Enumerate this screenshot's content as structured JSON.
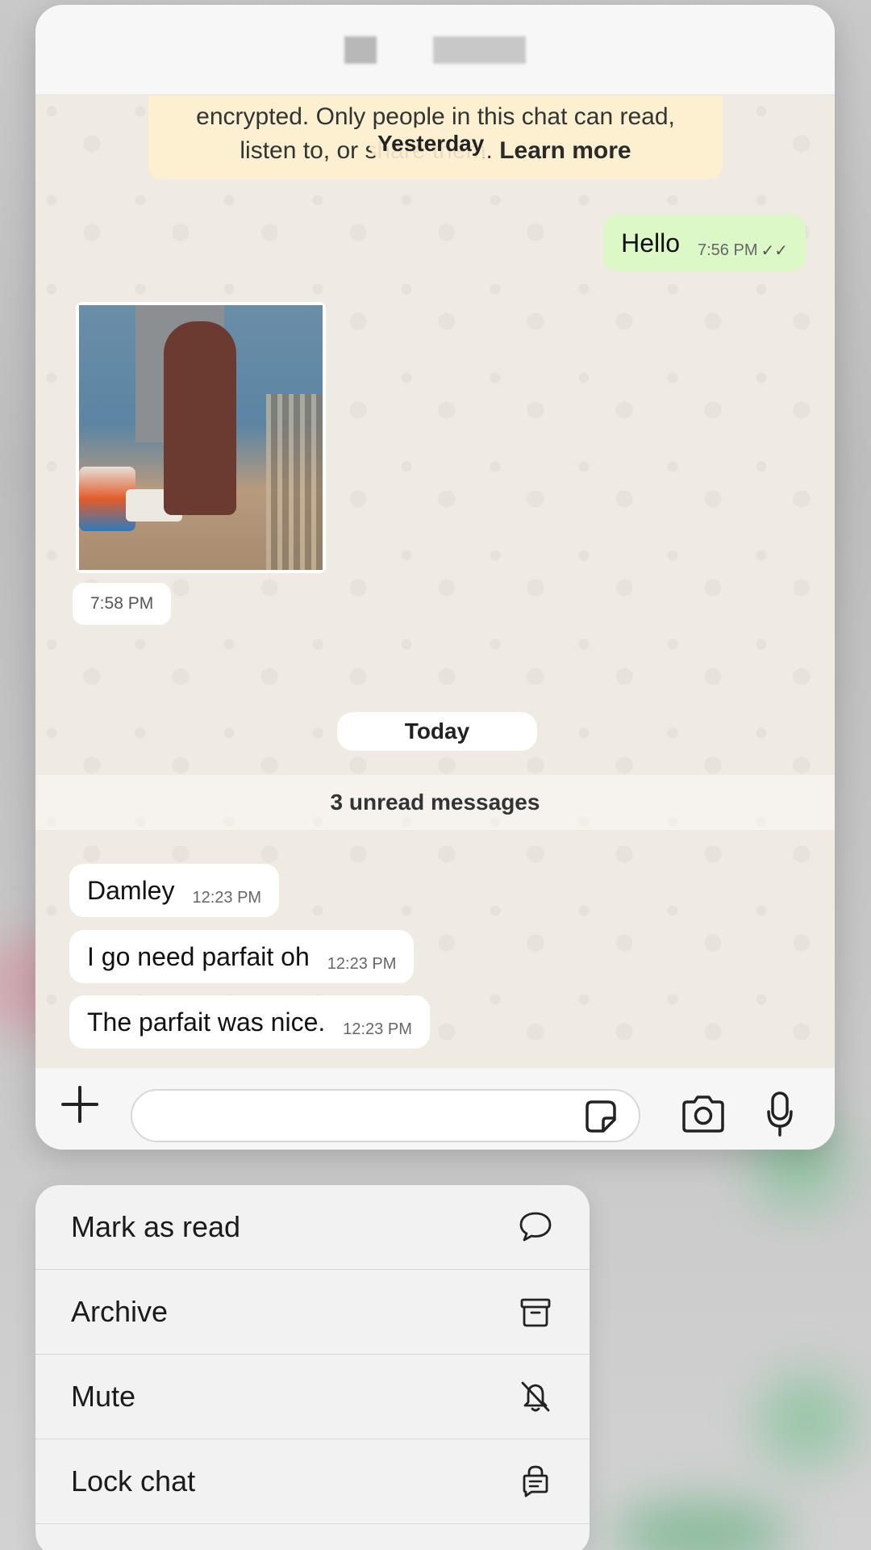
{
  "chat": {
    "encryption_text_line1": "encrypted. Only people in this chat can read,",
    "encryption_text_line2": "listen to, or share them.",
    "learn_more": "Learn more",
    "date_yesterday": "Yesterday",
    "date_today": "Today",
    "unread_banner": "3 unread messages",
    "messages": [
      {
        "direction": "out",
        "text": "Hello",
        "time": "7:56 PM",
        "status": "read"
      },
      {
        "direction": "in",
        "type": "photo",
        "time": "7:58 PM"
      },
      {
        "direction": "in",
        "text": "Damley",
        "time": "12:23 PM"
      },
      {
        "direction": "in",
        "text": "I go need parfait oh",
        "time": "12:23 PM"
      },
      {
        "direction": "in",
        "text": "The parfait was nice.",
        "time": "12:23 PM"
      }
    ]
  },
  "composer": {
    "placeholder": "",
    "icons": [
      "plus-icon",
      "sticker-icon",
      "camera-icon",
      "microphone-icon"
    ]
  },
  "context_menu": {
    "items": [
      {
        "label": "Mark as read",
        "icon": "chat-bubble-icon"
      },
      {
        "label": "Archive",
        "icon": "archive-box-icon"
      },
      {
        "label": "Mute",
        "icon": "bell-slash-icon"
      },
      {
        "label": "Lock chat",
        "icon": "lock-chat-icon"
      }
    ]
  },
  "colors": {
    "outgoing_bubble": "#dcf8c6",
    "incoming_bubble": "#ffffff",
    "notice_bg": "#fdf0d1",
    "chat_bg": "#efeae2"
  }
}
